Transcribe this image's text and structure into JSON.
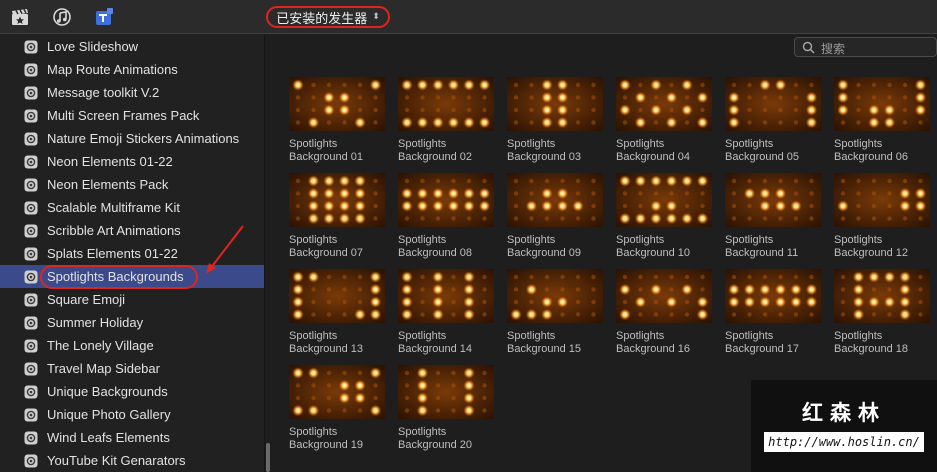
{
  "toolbar": {
    "generator_select": "已安装的发生器",
    "search_placeholder": "搜索"
  },
  "sidebar": {
    "items": [
      {
        "label": "Love Slideshow",
        "selected": false
      },
      {
        "label": "Map Route Animations",
        "selected": false
      },
      {
        "label": "Message toolkit V.2",
        "selected": false
      },
      {
        "label": "Multi Screen Frames Pack",
        "selected": false
      },
      {
        "label": "Nature Emoji Stickers Animations",
        "selected": false
      },
      {
        "label": "Neon Elements 01-22",
        "selected": false
      },
      {
        "label": "Neon Elements Pack",
        "selected": false
      },
      {
        "label": "Scalable Multiframe Kit",
        "selected": false
      },
      {
        "label": "Scribble Art Animations",
        "selected": false
      },
      {
        "label": "Splats Elements 01-22",
        "selected": false
      },
      {
        "label": "Spotlights Backgrounds",
        "selected": true
      },
      {
        "label": "Square Emoji",
        "selected": false
      },
      {
        "label": "Summer Holiday",
        "selected": false
      },
      {
        "label": "The Lonely Village",
        "selected": false
      },
      {
        "label": "Travel Map Sidebar",
        "selected": false
      },
      {
        "label": "Unique Backgrounds",
        "selected": false
      },
      {
        "label": "Unique Photo Gallery",
        "selected": false
      },
      {
        "label": "Wind Leafs Elements",
        "selected": false
      },
      {
        "label": "YouTube Kit Genarators",
        "selected": false
      }
    ]
  },
  "generators": [
    {
      "title": "Spotlights",
      "subtitle": "Background 01"
    },
    {
      "title": "Spotlights",
      "subtitle": "Background 02"
    },
    {
      "title": "Spotlights",
      "subtitle": "Background 03"
    },
    {
      "title": "Spotlights",
      "subtitle": "Background 04"
    },
    {
      "title": "Spotlights",
      "subtitle": "Background 05"
    },
    {
      "title": "Spotlights",
      "subtitle": "Background 06"
    },
    {
      "title": "Spotlights",
      "subtitle": "Background 07"
    },
    {
      "title": "Spotlights",
      "subtitle": "Background 08"
    },
    {
      "title": "Spotlights",
      "subtitle": "Background 09"
    },
    {
      "title": "Spotlights",
      "subtitle": "Background 10"
    },
    {
      "title": "Spotlights",
      "subtitle": "Background 11"
    },
    {
      "title": "Spotlights",
      "subtitle": "Background 12"
    },
    {
      "title": "Spotlights",
      "subtitle": "Background 13"
    },
    {
      "title": "Spotlights",
      "subtitle": "Background 14"
    },
    {
      "title": "Spotlights",
      "subtitle": "Background 15"
    },
    {
      "title": "Spotlights",
      "subtitle": "Background 16"
    },
    {
      "title": "Spotlights",
      "subtitle": "Background 17"
    },
    {
      "title": "Spotlights",
      "subtitle": "Background 18"
    },
    {
      "title": "Spotlights",
      "subtitle": "Background 19"
    },
    {
      "title": "Spotlights",
      "subtitle": "Background 20"
    }
  ],
  "watermark": {
    "title": "红森林",
    "url": "http://www.hoslin.cn/"
  },
  "colors": {
    "accent_selection": "#3b4a8a",
    "annotation_red": "#e0241f",
    "spotlight_glow": "#ffb733"
  }
}
